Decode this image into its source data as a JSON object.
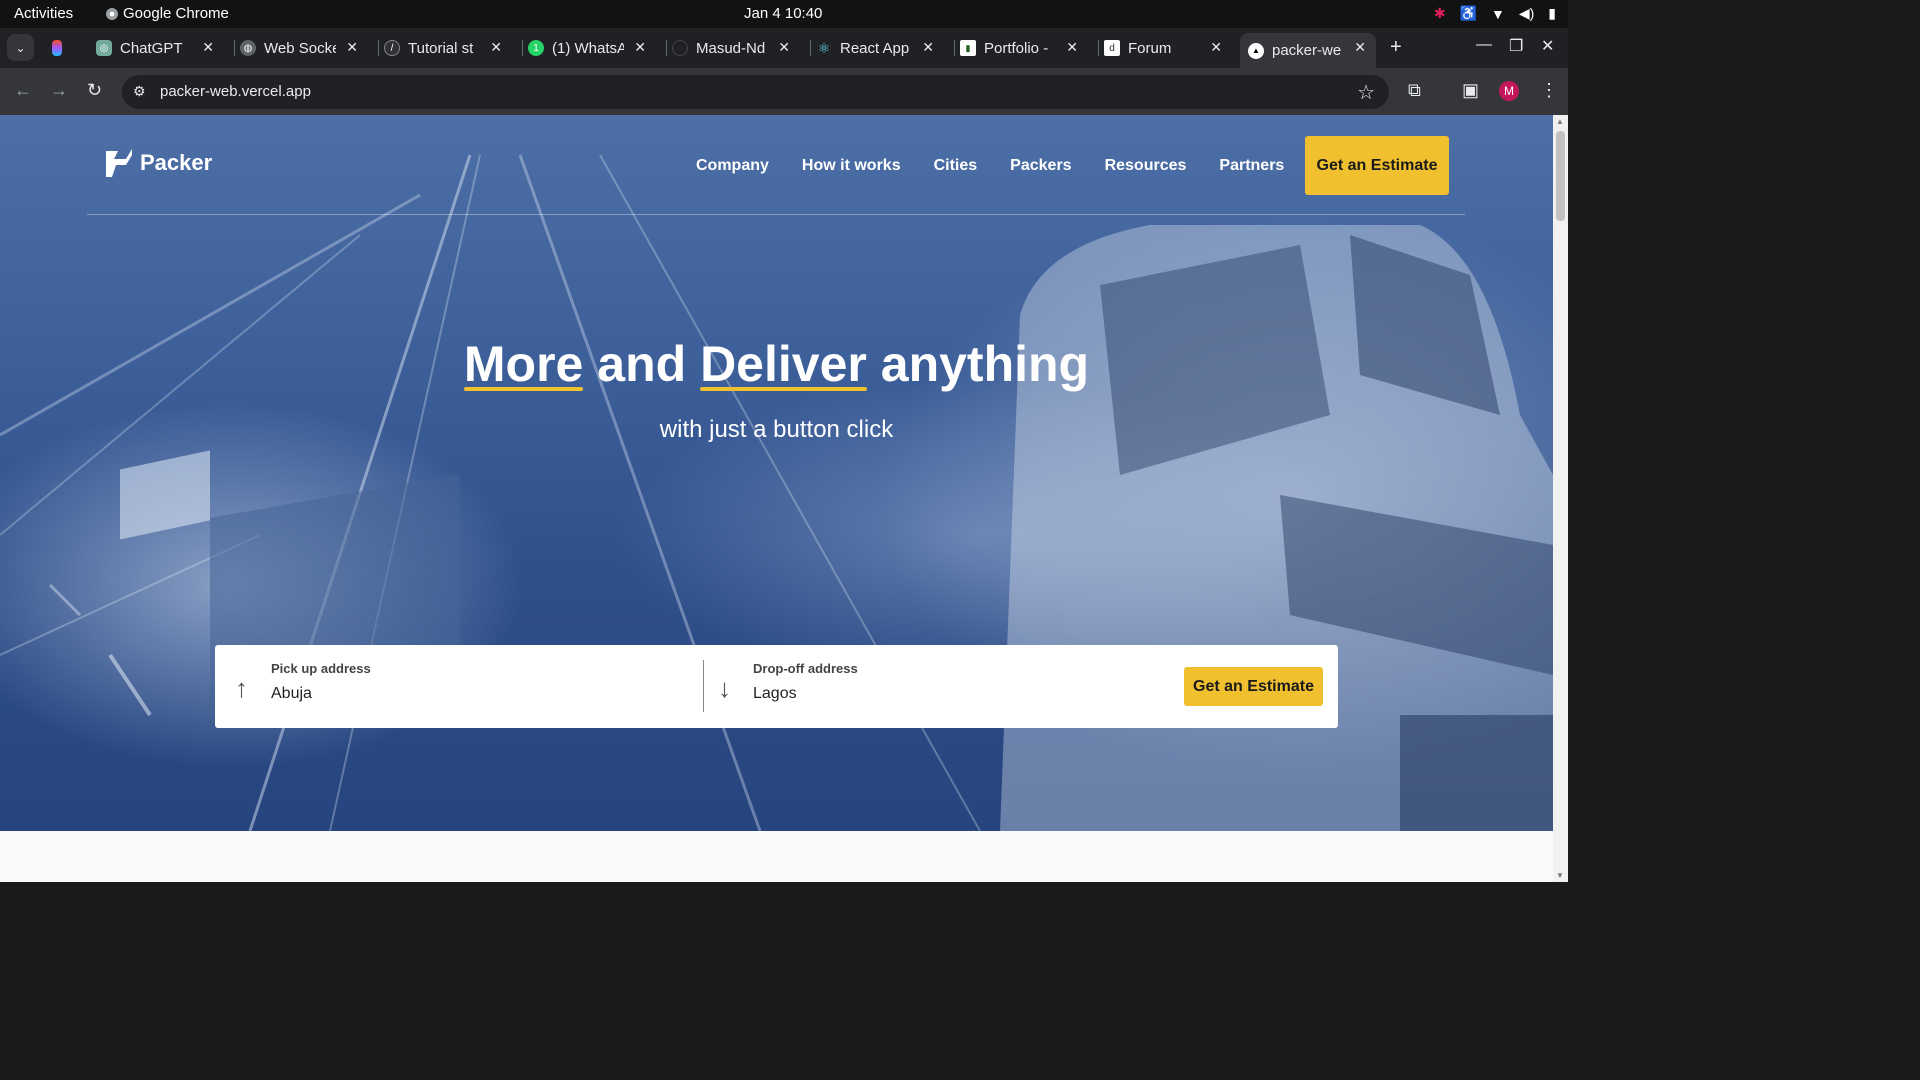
{
  "system": {
    "activities": "Activities",
    "app_name": "Google Chrome",
    "clock": "Jan 4  10:40"
  },
  "tabs": [
    {
      "title": "",
      "icon": "figma-icon"
    },
    {
      "title": "ChatGPT",
      "icon": "chatgpt-icon"
    },
    {
      "title": "Web Socke",
      "icon": "globe-icon"
    },
    {
      "title": "Tutorial st",
      "icon": "tutorial-icon"
    },
    {
      "title": "(1) WhatsA",
      "icon": "whatsapp-icon"
    },
    {
      "title": "Masud-Nd",
      "icon": "github-icon"
    },
    {
      "title": "React App",
      "icon": "react-icon"
    },
    {
      "title": "Portfolio -",
      "icon": "portfolio-icon"
    },
    {
      "title": "Forum",
      "icon": "forum-icon"
    },
    {
      "title": "packer-we",
      "icon": "vercel-icon",
      "active": true
    }
  ],
  "browser": {
    "url": "packer-web.vercel.app",
    "avatar_letter": "M"
  },
  "site": {
    "brand": "Packer",
    "nav": [
      "Company",
      "How it works",
      "Cities",
      "Packers",
      "Resources",
      "Partners"
    ],
    "cta": "Get an Estimate",
    "headline": {
      "word1": "More",
      "word2": "and",
      "word3": "Deliver",
      "word4": "anything"
    },
    "subheadline": "with just a button click",
    "pickup": {
      "label": "Pick up address",
      "value": "Abuja"
    },
    "dropoff": {
      "label": "Drop-off address",
      "value": "Lagos"
    },
    "estimate_button": "Get an Estimate"
  },
  "colors": {
    "accent": "#f0c02f",
    "hero": "#3d5f99"
  }
}
